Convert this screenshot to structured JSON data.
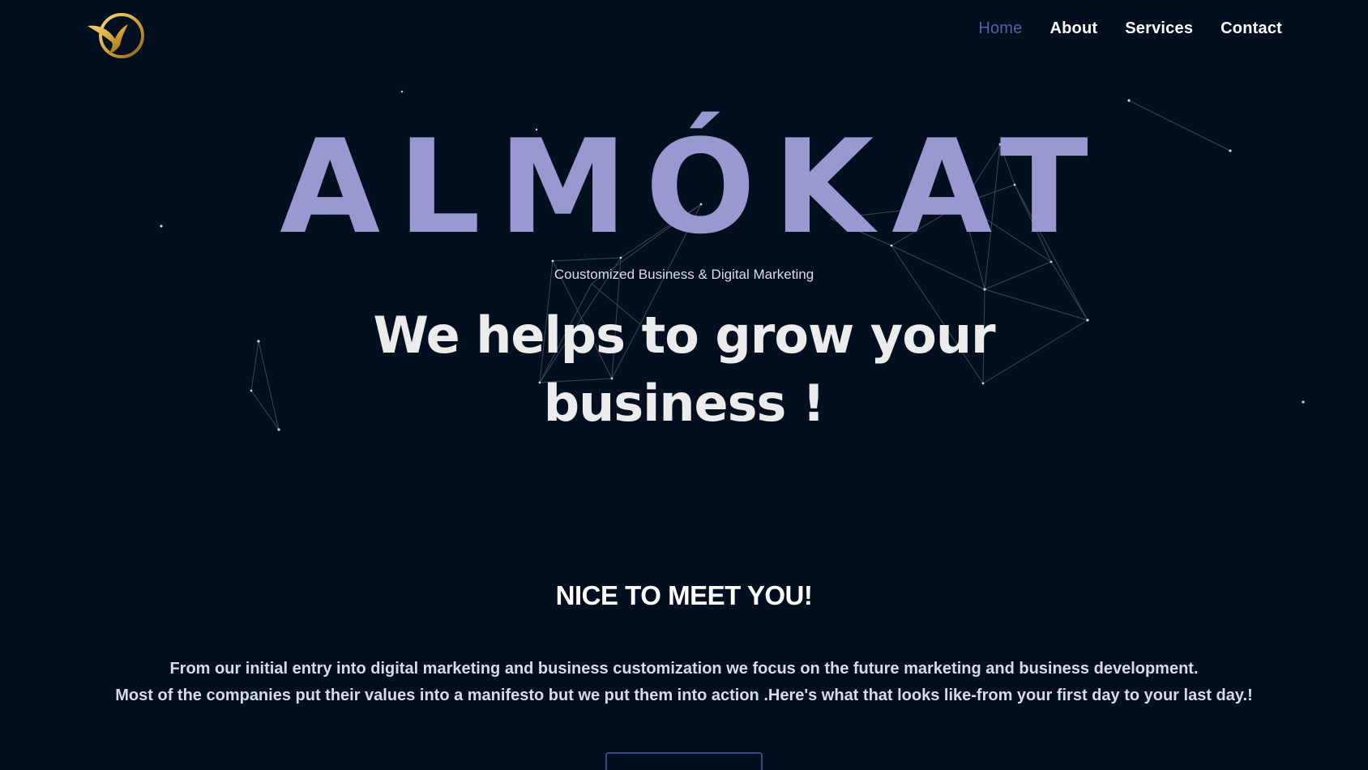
{
  "nav": {
    "items": [
      {
        "label": "Home",
        "active": true
      },
      {
        "label": "About",
        "active": false
      },
      {
        "label": "Services",
        "active": false
      },
      {
        "label": "Contact",
        "active": false
      }
    ]
  },
  "hero": {
    "brand": "ALMÓKAT",
    "tagline": "Coustomized Business & Digital Marketing",
    "headline_line1": "We helps to grow your",
    "headline_line2": "business !"
  },
  "about": {
    "title": "NICE TO MEET YOU!",
    "paragraph_line1": "From our initial entry into digital marketing and business customization we focus on the future marketing and business development.",
    "paragraph_line2": "Most of the companies put their values into a manifesto but we put them into action .Here's what that looks like-from your first day to your last day.!"
  },
  "icons": {
    "logo": "gold-bird-logo-icon"
  },
  "colors": {
    "background": "#020f1e",
    "brand": "#9a98d0",
    "nav_active": "#5a5ea8",
    "logo_gold": "#d8a838",
    "button_border": "#3d4a82"
  }
}
